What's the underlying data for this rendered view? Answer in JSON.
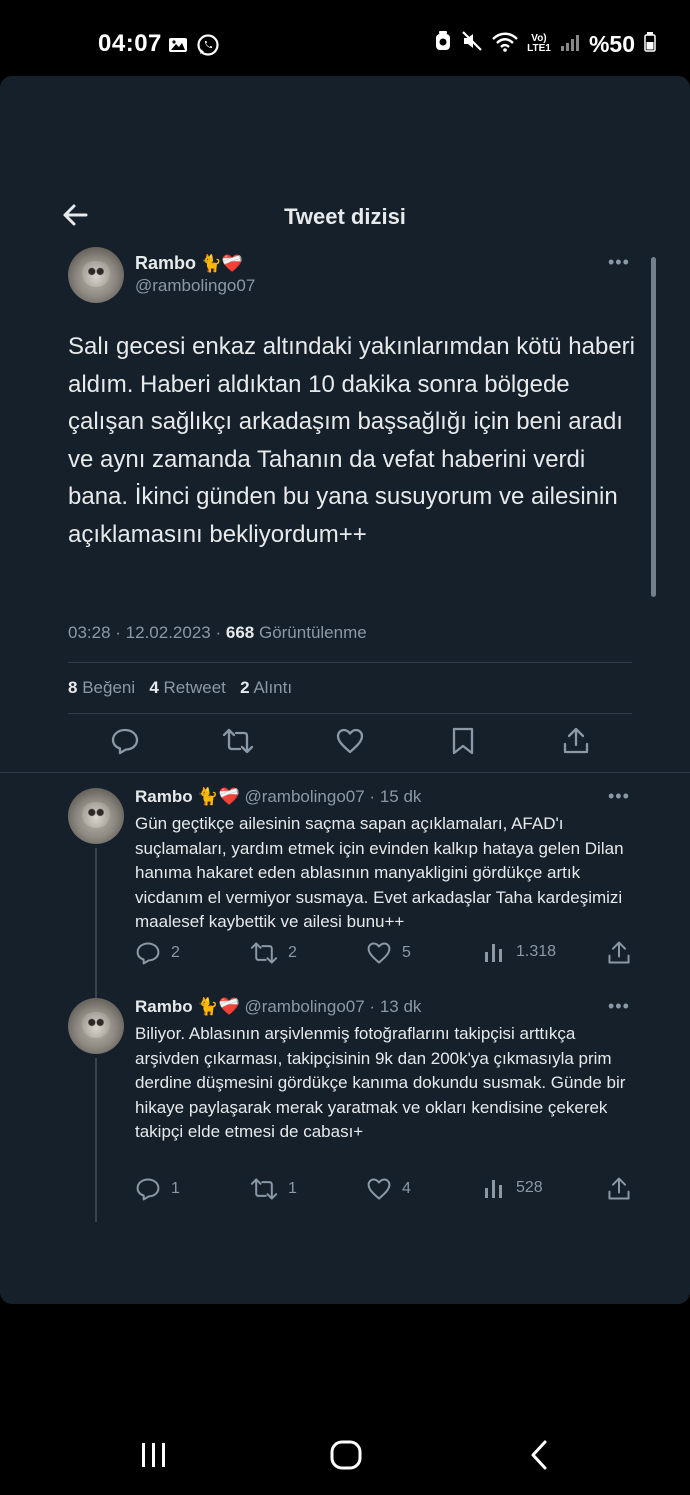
{
  "status_bar": {
    "time": "04:07",
    "network": "Vo) LTE1",
    "battery": "%50",
    "left_icons": [
      "image-icon",
      "whatsapp-icon"
    ],
    "right_icons": [
      "alarm-icon",
      "mute-icon",
      "wifi-icon",
      "signal-icon",
      "battery-icon"
    ]
  },
  "header": {
    "title": "Tweet dizisi"
  },
  "main_tweet": {
    "display_name": "Rambo",
    "emojis": "🐈❤️‍🩹",
    "handle": "@rambolingo07",
    "text": "Salı gecesi enkaz altındaki yakınlarımdan kötü haberi aldım. Haberi aldıktan 10 dakika sonra bölgede çalışan sağlıkçı arkadaşım başsağlığı için beni aradı ve aynı zamanda Tahanın da vefat haberini verdi bana. İkinci günden bu yana susuyorum ve ailesinin açıklamasını bekliyordum++",
    "time": "03:28 · 12.02.2023 ·",
    "views_count": "668",
    "views_label": "Görüntülenme",
    "likes_count": "8",
    "likes_label": "Beğeni",
    "retweets_count": "4",
    "retweets_label": "Retweet",
    "quotes_count": "2",
    "quotes_label": "Alıntı"
  },
  "replies": [
    {
      "display_name": "Rambo",
      "emojis": "🐈❤️‍🩹",
      "handle_time": "@rambolingo07 · 15 dk",
      "text": "Gün geçtikçe ailesinin saçma sapan açıklamaları, AFAD'ı suçlamaları, yardım etmek için evinden kalkıp hataya gelen Dilan hanıma hakaret eden ablasının manyakligini gördükçe artık vicdanım el vermiyor susmaya. Evet arkadaşlar Taha kardeşimizi maalesef kaybettik ve ailesi bunu++",
      "replies": "2",
      "retweets": "2",
      "likes": "5",
      "views": "1.318"
    },
    {
      "display_name": "Rambo",
      "emojis": "🐈❤️‍🩹",
      "handle_time": "@rambolingo07 · 13 dk",
      "text": "Biliyor. Ablasının arşivlenmiş fotoğraflarını takipçisi arttıkça arşivden çıkarması, takipçisinin 9k dan 200k'ya çıkmasıyla prim derdine düşmesini gördükçe kanıma dokundu susmak. Günde bir hikaye paylaşarak merak yaratmak ve okları kendisine çekerek takipçi elde etmesi de cabası+",
      "replies": "1",
      "retweets": "1",
      "likes": "4",
      "views": "528"
    }
  ],
  "colors": {
    "background": "#15202b",
    "text": "#e7e9ea",
    "secondary": "#8b98a5",
    "divider": "#2f3b47"
  }
}
